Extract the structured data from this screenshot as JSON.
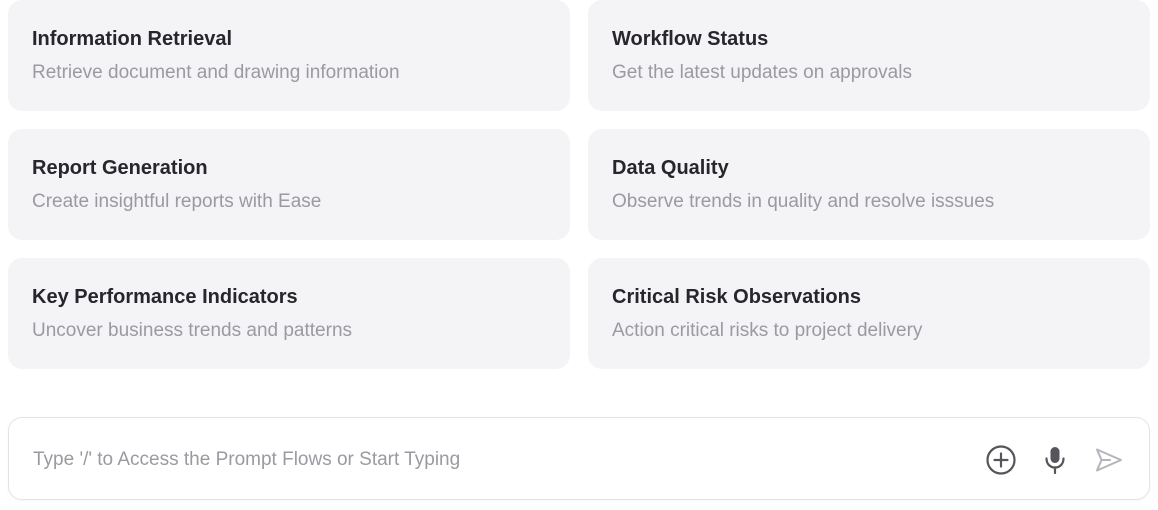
{
  "cards": [
    {
      "title": "Information Retrieval",
      "description": "Retrieve document and drawing information"
    },
    {
      "title": "Workflow Status",
      "description": "Get the latest updates on approvals"
    },
    {
      "title": "Report Generation",
      "description": "Create insightful reports with Ease"
    },
    {
      "title": "Data Quality",
      "description": "Observe trends in quality and resolve isssues"
    },
    {
      "title": "Key Performance Indicators",
      "description": "Uncover business trends and patterns"
    },
    {
      "title": "Critical Risk Observations",
      "description": "Action critical risks to project delivery"
    }
  ],
  "prompt": {
    "placeholder": "Type '/' to Access the Prompt Flows or Start Typing",
    "value": "",
    "icons": {
      "add": "plus-circle-icon",
      "mic": "microphone-icon",
      "send": "send-icon"
    }
  },
  "colors": {
    "card_background": "#f4f3f6",
    "title_text": "#26262b",
    "description_text": "#9a9aa1",
    "icon_active": "#55555c",
    "icon_disabled": "#b4b4ba"
  }
}
